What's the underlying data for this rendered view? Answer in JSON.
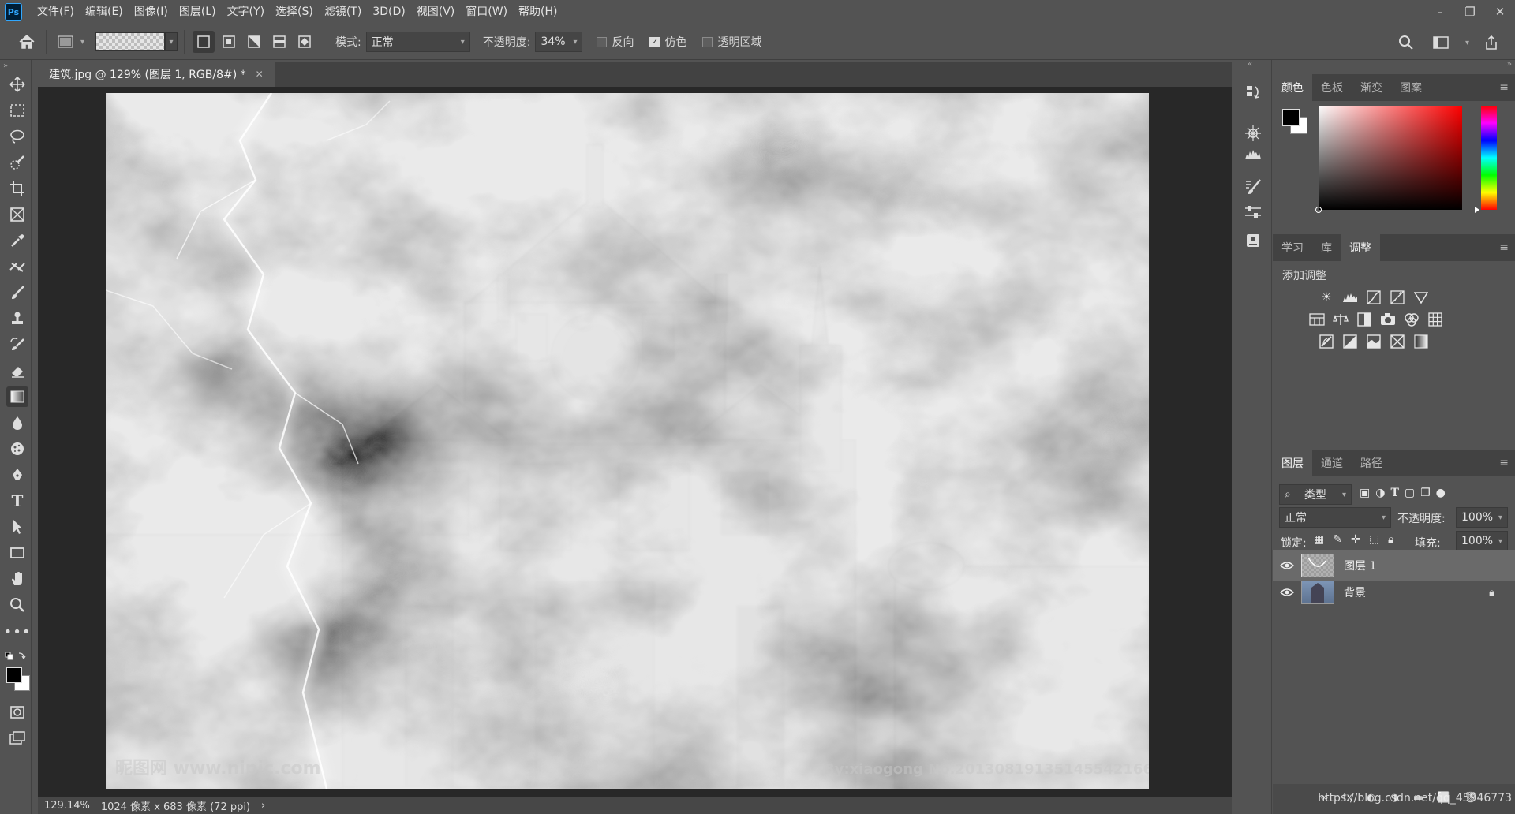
{
  "app": {
    "logo_text": "Ps"
  },
  "menu": [
    "文件(F)",
    "编辑(E)",
    "图像(I)",
    "图层(L)",
    "文字(Y)",
    "选择(S)",
    "滤镜(T)",
    "3D(D)",
    "视图(V)",
    "窗口(W)",
    "帮助(H)"
  ],
  "options": {
    "mode_label": "模式:",
    "mode_value": "正常",
    "opacity_label": "不透明度:",
    "opacity_value": "34%",
    "reverse_label": "反向",
    "dither_label": "仿色",
    "transparency_label": "透明区域",
    "reverse_checked": false,
    "dither_checked": true,
    "transparency_checked": false
  },
  "document": {
    "tab_title": "建筑.jpg @ 129% (图层 1, RGB/8#) *",
    "watermark_left": "昵图网 www.nipic.com",
    "watermark_right": "By:xiaogong  No.20130819135145542166"
  },
  "status": {
    "zoom": "129.14%",
    "doc_info": "1024 像素 x 683 像素 (72 ppi)",
    "arrow": "›"
  },
  "color_panel": {
    "tabs": [
      "颜色",
      "色板",
      "渐变",
      "图案"
    ],
    "active": 0
  },
  "adjust_panel": {
    "tabs": [
      "学习",
      "库",
      "调整"
    ],
    "active": 2,
    "heading": "添加调整"
  },
  "layers_panel": {
    "tabs": [
      "图层",
      "通道",
      "路径"
    ],
    "active": 0,
    "filter_label": "类型",
    "blend_mode": "正常",
    "opacity_label": "不透明度:",
    "opacity_value": "100%",
    "lock_label": "锁定:",
    "fill_label": "填充:",
    "fill_value": "100%",
    "layers": [
      {
        "name": "图层 1",
        "visible": true,
        "selected": true,
        "locked": false
      },
      {
        "name": "背景",
        "visible": true,
        "selected": false,
        "locked": true
      }
    ]
  },
  "url_watermark": "https://blog.csdn.net/qq_45946773",
  "colors": {
    "accent": "#31a8ff",
    "panel": "#535353",
    "dark": "#424242",
    "canvas_bg": "#282828"
  }
}
